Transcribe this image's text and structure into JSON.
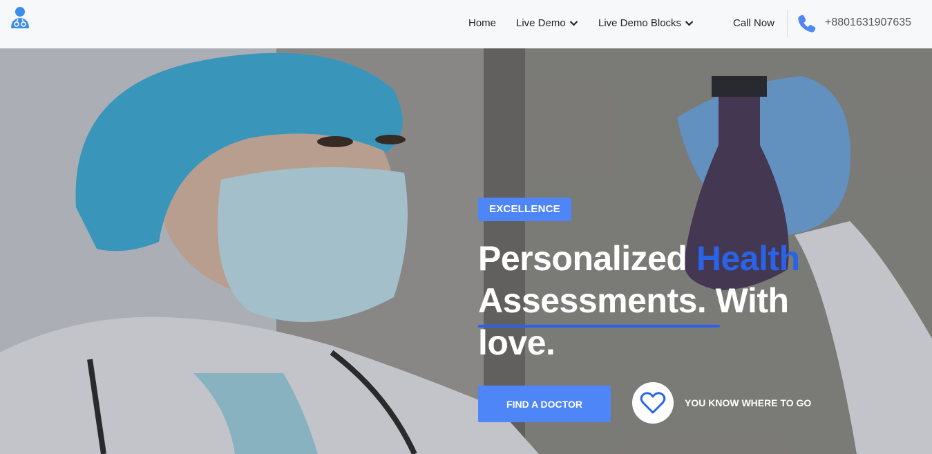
{
  "header": {
    "logo_icon": "doctor-icon",
    "nav": [
      {
        "label": "Home",
        "has_dropdown": false
      },
      {
        "label": "Live Demo",
        "has_dropdown": true
      },
      {
        "label": "Live Demo Blocks",
        "has_dropdown": true
      }
    ],
    "call_label": "Call Now",
    "phone_icon": "phone-icon",
    "phone_number": "+8801631907635"
  },
  "hero": {
    "badge": "EXCELLENCE",
    "headline_part1": "Personalized ",
    "headline_accent": "Health",
    "headline_part2": " Assessments. With love.",
    "cta_label": "FIND A DOCTOR",
    "heart_icon": "heart-icon",
    "tagline": "YOU KNOW WHERE TO GO"
  },
  "colors": {
    "accent": "#4f86f7",
    "headline_accent": "#2a63e8",
    "logo": "#3b8ee8"
  }
}
